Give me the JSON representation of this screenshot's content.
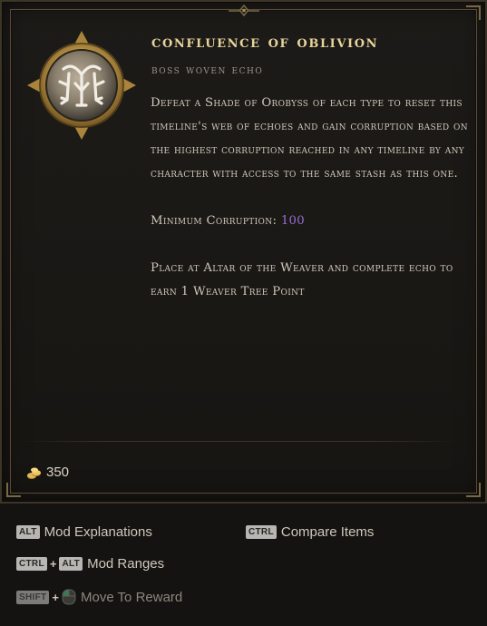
{
  "item": {
    "title": "Confluence of Oblivion",
    "subtitle": "Boss Woven Echo",
    "description": "Defeat a Shade of Orobyss of each type to reset this timeline's web of echoes and gain corruption based on the highest corruption reached in any timeline by any character with access to the same stash as this one.",
    "min_corruption_label": "Minimum Corruption:",
    "min_corruption_value": "100",
    "placement": "Place at Altar of the Weaver and complete echo to earn 1 Weaver Tree Point",
    "gold_value": "350",
    "emblem_icon": "weaver-rune-emblem-icon",
    "gold_icon": "gold-coins-icon"
  },
  "help": {
    "mod_explanations": {
      "keys": [
        "ALT"
      ],
      "label": "Mod Explanations"
    },
    "compare_items": {
      "keys": [
        "CTRL"
      ],
      "label": "Compare Items"
    },
    "mod_ranges": {
      "keys": [
        "CTRL",
        "ALT"
      ],
      "label": "Mod Ranges"
    },
    "move_to_reward": {
      "keys": [
        "SHIFT"
      ],
      "label": "Move To Reward",
      "mouse_icon": "left-mouse-button-icon"
    }
  },
  "colors": {
    "title": "#e8d49a",
    "subtitle": "#9b938a",
    "text": "#cfc7ba",
    "corruption_value": "#9b6fd6",
    "frame": "#5a4c35"
  }
}
